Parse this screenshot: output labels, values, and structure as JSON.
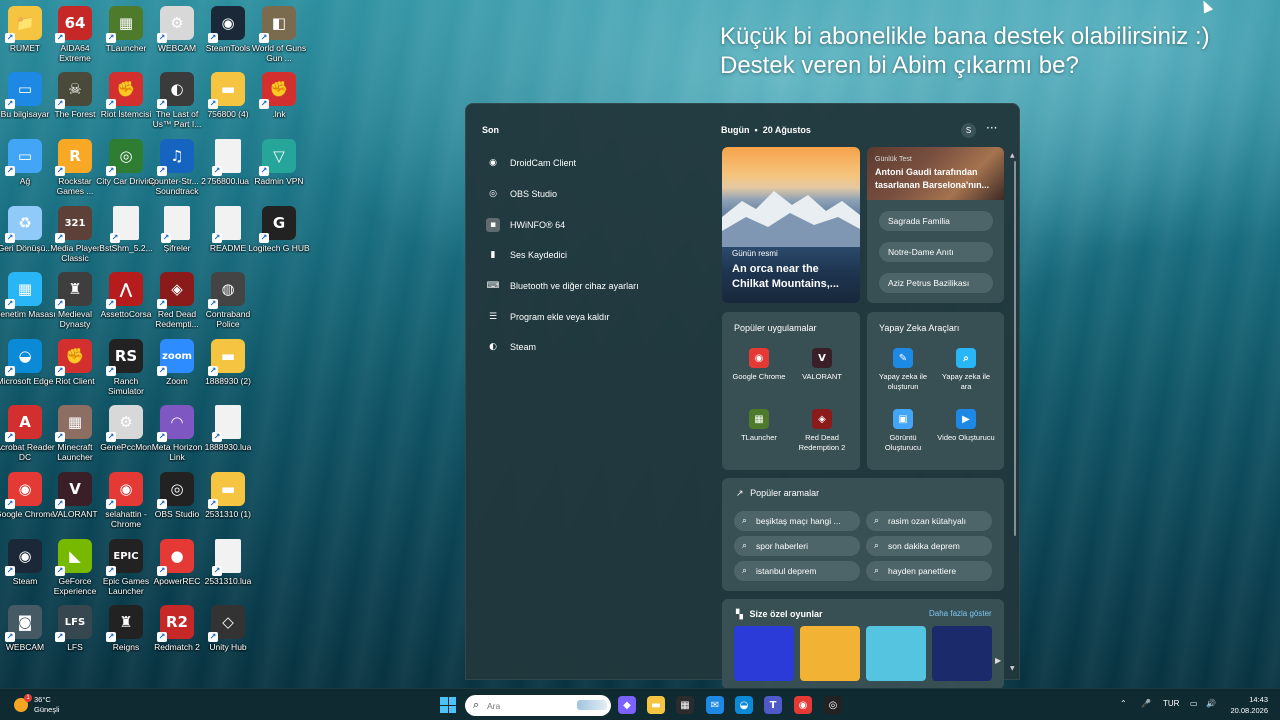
{
  "desktop": {
    "icons": [
      {
        "label": "RUMET",
        "glyph": "📁",
        "bg": "#f5c542"
      },
      {
        "label": "AIDA64 Extreme",
        "glyph": "64",
        "bg": "#c62828"
      },
      {
        "label": "TLauncher",
        "glyph": "▦",
        "bg": "#4e7a2c"
      },
      {
        "label": "WEBCAM",
        "glyph": "⚙",
        "bg": "#d8d8d8"
      },
      {
        "label": "SteamTools",
        "glyph": "◉",
        "bg": "#1b2838"
      },
      {
        "label": "World of Guns Gun ...",
        "glyph": "◧",
        "bg": "#7a6a4e"
      },
      {
        "label": "Bu bilgisayar",
        "glyph": "▭",
        "bg": "#1e88e5"
      },
      {
        "label": "The Forest",
        "glyph": "☠",
        "bg": "#4a4a3a"
      },
      {
        "label": "Riot İstemcisi",
        "glyph": "✊",
        "bg": "#d32f2f"
      },
      {
        "label": "The Last of Us™ Part I...",
        "glyph": "◐",
        "bg": "#3b3b3b"
      },
      {
        "label": "756800 (4)",
        "glyph": "▬",
        "bg": "#f5c542"
      },
      {
        "label": ".lnk",
        "glyph": "✊",
        "bg": "#d32f2f"
      },
      {
        "label": "Ağ",
        "glyph": "▭",
        "bg": "#42a5f5"
      },
      {
        "label": "Rockstar Games ...",
        "glyph": "R",
        "bg": "#f9a825"
      },
      {
        "label": "City Car Driving",
        "glyph": "◎",
        "bg": "#2e7d32"
      },
      {
        "label": "Counter-Str... 2 Soundtrack",
        "glyph": "♫",
        "bg": "#1565c0"
      },
      {
        "label": "756800.lua",
        "glyph": "",
        "bg": "#f2f2f2"
      },
      {
        "label": "Radmin VPN",
        "glyph": "▽",
        "bg": "#26a69a"
      },
      {
        "label": "Geri Dönüşü...",
        "glyph": "♻",
        "bg": "#90caf9"
      },
      {
        "label": "Media Player Classic",
        "glyph": "321",
        "bg": "#5d4037"
      },
      {
        "label": "BstShm_5.2...",
        "glyph": "",
        "bg": "#f2f2f2"
      },
      {
        "label": "Şifreler",
        "glyph": "",
        "bg": "#f2f2f2"
      },
      {
        "label": "README",
        "glyph": "",
        "bg": "#f2f2f2"
      },
      {
        "label": "Logitech G HUB",
        "glyph": "G",
        "bg": "#222222"
      },
      {
        "label": "Denetim Masası",
        "glyph": "▦",
        "bg": "#29b6f6"
      },
      {
        "label": "Medieval Dynasty",
        "glyph": "♜",
        "bg": "#3e3e3e"
      },
      {
        "label": "AssettoCorsa",
        "glyph": "⋀",
        "bg": "#b71c1c"
      },
      {
        "label": "Red Dead Redempti...",
        "glyph": "◈",
        "bg": "#8b1a1a"
      },
      {
        "label": "Contraband Police",
        "glyph": "◍",
        "bg": "#444444"
      },
      {
        "label": "",
        "glyph": "",
        "bg": "transparent"
      },
      {
        "label": "Microsoft Edge",
        "glyph": "◒",
        "bg": "#0b8ad8"
      },
      {
        "label": "Riot Client",
        "glyph": "✊",
        "bg": "#d32f2f"
      },
      {
        "label": "Ranch Simulator",
        "glyph": "RS",
        "bg": "#222222"
      },
      {
        "label": "Zoom",
        "glyph": "zoom",
        "bg": "#2d8cff"
      },
      {
        "label": "1888930 (2)",
        "glyph": "▬",
        "bg": "#f5c542"
      },
      {
        "label": "",
        "glyph": "",
        "bg": "transparent"
      },
      {
        "label": "Acrobat Reader DC",
        "glyph": "A",
        "bg": "#d32f2f"
      },
      {
        "label": "Minecraft Launcher",
        "glyph": "▦",
        "bg": "#8d6e63"
      },
      {
        "label": "GenePccMon",
        "glyph": "⚙",
        "bg": "#d8d8d8"
      },
      {
        "label": "Meta Horizon Link",
        "glyph": "◠",
        "bg": "#7e57c2"
      },
      {
        "label": "1888930.lua",
        "glyph": "",
        "bg": "#f2f2f2"
      },
      {
        "label": "",
        "glyph": "",
        "bg": "transparent"
      },
      {
        "label": "Google Chrome",
        "glyph": "◉",
        "bg": "#e53935"
      },
      {
        "label": "VALORANT",
        "glyph": "V",
        "bg": "#3a1f28"
      },
      {
        "label": "selahattin - Chrome",
        "glyph": "◉",
        "bg": "#e53935"
      },
      {
        "label": "OBS Studio",
        "glyph": "◎",
        "bg": "#222222"
      },
      {
        "label": "2531310 (1)",
        "glyph": "▬",
        "bg": "#f5c542"
      },
      {
        "label": "",
        "glyph": "",
        "bg": "transparent"
      },
      {
        "label": "Steam",
        "glyph": "◉",
        "bg": "#1b2838"
      },
      {
        "label": "GeForce Experience",
        "glyph": "◣",
        "bg": "#76b900"
      },
      {
        "label": "Epic Games Launcher",
        "glyph": "EPIC",
        "bg": "#222222"
      },
      {
        "label": "ApowerREC",
        "glyph": "●",
        "bg": "#e53935"
      },
      {
        "label": "2531310.lua",
        "glyph": "",
        "bg": "#f2f2f2"
      },
      {
        "label": "",
        "glyph": "",
        "bg": "transparent"
      },
      {
        "label": "WEBCAM",
        "glyph": "◙",
        "bg": "#455a64"
      },
      {
        "label": "LFS",
        "glyph": "LFS",
        "bg": "#37474f"
      },
      {
        "label": "Reigns",
        "glyph": "♜",
        "bg": "#222222"
      },
      {
        "label": "Redmatch 2",
        "glyph": "R2",
        "bg": "#c62828"
      },
      {
        "label": "Unity Hub",
        "glyph": "◇",
        "bg": "#333333"
      },
      {
        "label": "",
        "glyph": "",
        "bg": "transparent"
      }
    ]
  },
  "promo_text": {
    "line1": "Küçük bi abonelikle bana destek olabilirsiniz :)",
    "line2": "Destek veren bi Abim çıkarmı be?"
  },
  "panel": {
    "recent_title": "Son",
    "recent": [
      {
        "label": "DroidCam Client",
        "icon": "camera-icon",
        "glyph": "◉"
      },
      {
        "label": "OBS Studio",
        "icon": "obs-icon",
        "glyph": "◎"
      },
      {
        "label": "HWiNFO® 64",
        "icon": "hwinfo-icon",
        "glyph": "▪"
      },
      {
        "label": "Ses Kaydedici",
        "icon": "microphone-icon",
        "glyph": "▮"
      },
      {
        "label": "Bluetooth ve diğer cihaz ayarları",
        "icon": "devices-icon",
        "glyph": "⌨"
      },
      {
        "label": "Program ekle veya kaldır",
        "icon": "apps-list-icon",
        "glyph": "☰"
      },
      {
        "label": "Steam",
        "icon": "steam-icon",
        "glyph": "◐"
      }
    ],
    "today_label": "Bugün",
    "date": "20 Ağustos",
    "avatar_initial": "S",
    "more_glyph": "···",
    "picture_of_day": {
      "small": "Günün resmi",
      "title": "An orca near the Chilkat Mountains,..."
    },
    "test_card": {
      "kicker": "Günlük Test",
      "title": "Antoni Gaudi tarafından tasarlanan Barselona'nın...",
      "options": [
        "Sagrada Familia",
        "Notre-Dame Anıtı",
        "Aziz Petrus Bazilikası"
      ]
    },
    "popular_apps": {
      "title": "Popüler uygulamalar",
      "apps": [
        {
          "label": "Google Chrome",
          "glyph": "◉",
          "bg": "#e53935"
        },
        {
          "label": "VALORANT",
          "glyph": "V",
          "bg": "#3a1f28"
        },
        {
          "label": "TLauncher",
          "glyph": "▦",
          "bg": "#4e7a2c"
        },
        {
          "label": "Red Dead Redemption 2",
          "glyph": "◈",
          "bg": "#8b1a1a"
        }
      ]
    },
    "ai_tools": {
      "title": "Yapay Zeka Araçları",
      "tools": [
        {
          "label": "Yapay zeka ile oluşturun",
          "glyph": "✎",
          "bg": "#1e88e5"
        },
        {
          "label": "Yapay zeka ile ara",
          "glyph": "⌕",
          "bg": "#29b6f6"
        },
        {
          "label": "Görüntü Oluşturucu",
          "glyph": "▣",
          "bg": "#42a5f5"
        },
        {
          "label": "Video Oluşturucu",
          "glyph": "▶",
          "bg": "#1e88e5"
        }
      ]
    },
    "popular_searches": {
      "title": "Popüler aramalar",
      "items": [
        "beşiktaş maçı hangi ...",
        "rasim ozan kütahyalı",
        "spor haberleri",
        "son dakika deprem",
        "istanbul deprem",
        "hayden panettiere"
      ]
    },
    "games": {
      "title": "Size özel oyunlar",
      "see_more": "Daha fazla göster",
      "colors": [
        "#2a3bd8",
        "#f2b233",
        "#55c4e0",
        "#1b2a6b"
      ]
    }
  },
  "taskbar": {
    "temperature": "36°C",
    "weather": "Güneşli",
    "weather_badge": "1",
    "search_placeholder": "Ara",
    "language": "TUR",
    "time": "14:43",
    "date": "20.08.2026",
    "apps": [
      {
        "name": "copilot-icon",
        "glyph": "◆",
        "bg": "#7b61ff"
      },
      {
        "name": "file-explorer-icon",
        "glyph": "▬",
        "bg": "#f5c542"
      },
      {
        "name": "store-icon",
        "glyph": "▦",
        "bg": "#2b2b2b"
      },
      {
        "name": "mail-icon",
        "glyph": "✉",
        "bg": "#1e88e5"
      },
      {
        "name": "edge-icon",
        "glyph": "◒",
        "bg": "#0b8ad8"
      },
      {
        "name": "teams-icon",
        "glyph": "T",
        "bg": "#5059c9"
      },
      {
        "name": "chrome-icon",
        "glyph": "◉",
        "bg": "#e53935"
      },
      {
        "name": "recorder-icon",
        "glyph": "◎",
        "bg": "#222222"
      }
    ]
  }
}
